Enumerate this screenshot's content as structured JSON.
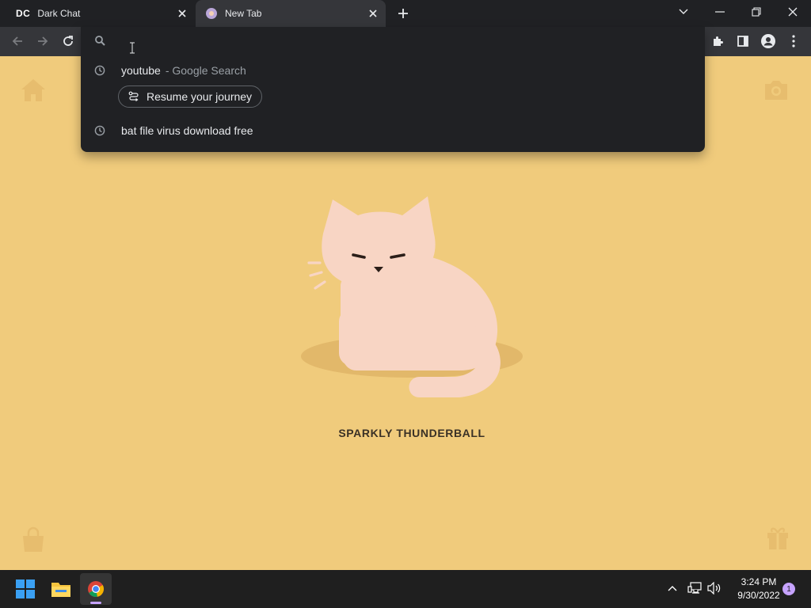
{
  "browser": {
    "tabs": [
      {
        "favicon_text": "DC",
        "title": "Dark Chat",
        "active": false
      },
      {
        "title": "New Tab",
        "active": true
      }
    ]
  },
  "omnibox": {
    "value": "",
    "suggestions": [
      {
        "main": "youtube",
        "sub": "- Google Search",
        "icon": "clock-icon"
      },
      {
        "main": "bat file virus download free",
        "icon": "clock-icon"
      }
    ],
    "chip_label": "Resume your journey"
  },
  "page": {
    "title": "SPARKLY THUNDERBALL"
  },
  "taskbar": {
    "time": "3:24 PM",
    "date": "9/30/2022",
    "notification_count": "1"
  },
  "colors": {
    "page_bg": "#f0cb7c",
    "cat": "#f8d5c4",
    "chrome_dark": "#202124",
    "toolbar": "#35363a"
  }
}
